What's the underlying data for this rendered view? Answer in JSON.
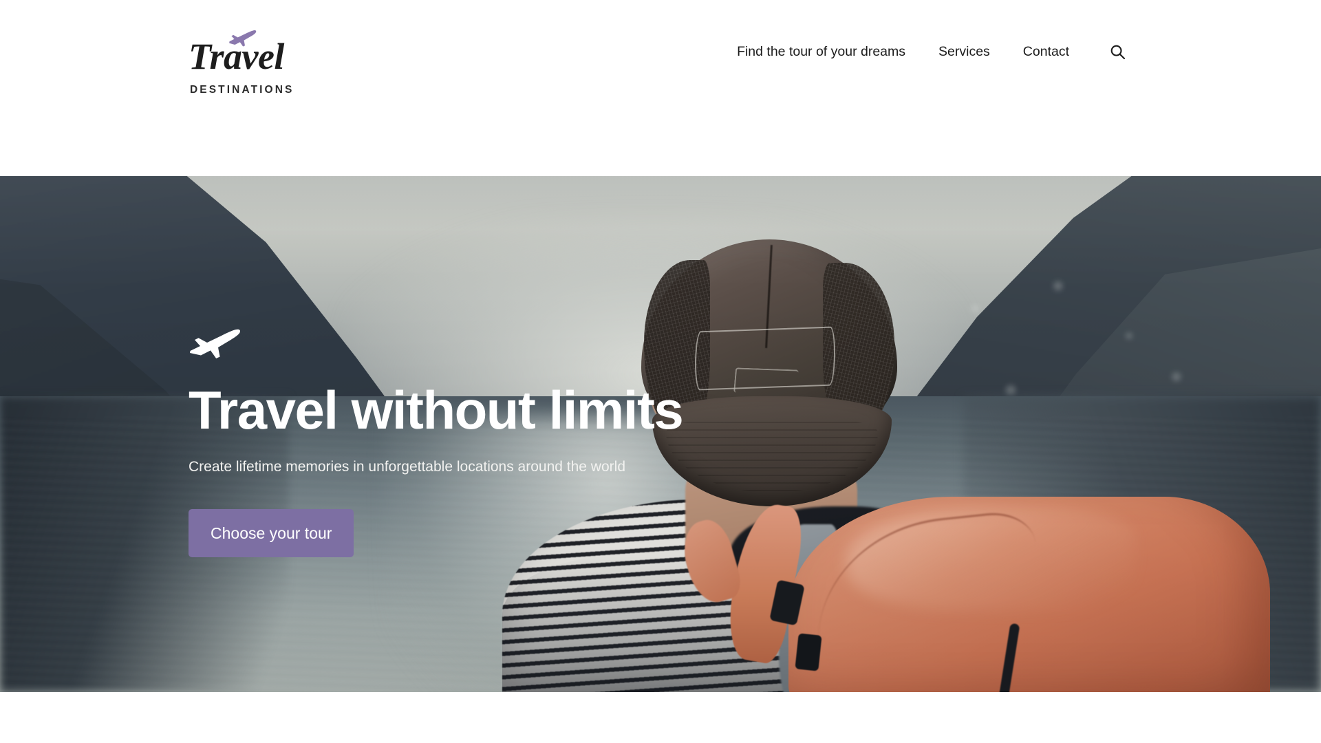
{
  "brand": {
    "name": "Travel",
    "tagline": "DESTINATIONS",
    "plane_icon": "airplane-icon",
    "accent_color": "#7d6fa3"
  },
  "nav": {
    "items": [
      {
        "label": "Find the tour of your dreams"
      },
      {
        "label": "Services"
      },
      {
        "label": "Contact"
      }
    ],
    "search_icon": "search-icon"
  },
  "hero": {
    "plane_icon": "airplane-takeoff-icon",
    "title": "Travel without limits",
    "subtitle": "Create lifetime memories in unforgettable locations around the world",
    "cta_label": "Choose your tour",
    "cta_color": "#7d6fa3",
    "image_alt": "Man with orange backpack and cap looking out over a mountain lake"
  }
}
